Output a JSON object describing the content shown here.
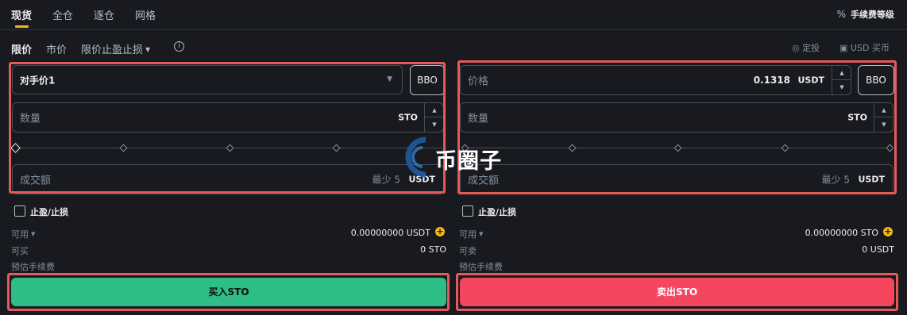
{
  "tabs": [
    "现货",
    "全仓",
    "逐仓",
    "网格"
  ],
  "fee_level": {
    "icon": "percent-icon",
    "label": "手续费等级"
  },
  "order_types": [
    "限价",
    "市价",
    "限价止盈止损"
  ],
  "order_type_dropdown_icon": "caret-down-icon",
  "top_right": {
    "dca": "定投",
    "buy_with_usd": "USD 买币"
  },
  "buy": {
    "price_select": "对手价1",
    "bbo": "BBO",
    "amount_label": "数量",
    "amount_unit": "STO",
    "total_label": "成交额",
    "total_min": "最少 5",
    "total_unit": "USDT",
    "tpsl_label": "止盈/止损",
    "available_label": "可用",
    "available_value": "0.00000000 USDT",
    "max_label": "可买",
    "max_value": "0 STO",
    "fee_label": "预估手续费",
    "button": "买入STO"
  },
  "sell": {
    "price_label": "价格",
    "price_value": "0.1318",
    "price_unit": "USDT",
    "bbo": "BBO",
    "amount_label": "数量",
    "amount_unit": "STO",
    "total_label": "成交额",
    "total_min": "最少 5",
    "total_unit": "USDT",
    "tpsl_label": "止盈/止损",
    "available_label": "可用",
    "available_value": "0.00000000 STO",
    "max_label": "可卖",
    "max_value": "0 USDT",
    "fee_label": "预估手续费",
    "button": "卖出STO"
  },
  "watermark": "币圈子",
  "colors": {
    "buy": "#2ebd85",
    "sell": "#f6465d",
    "accent": "#f0b90b",
    "highlight": "#e45a5a"
  }
}
